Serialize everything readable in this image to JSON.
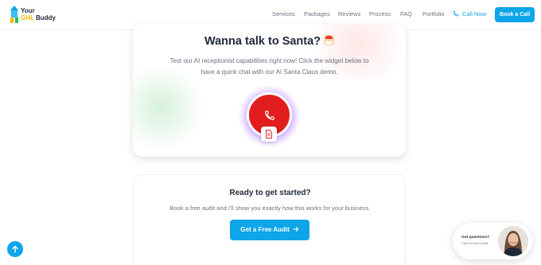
{
  "header": {
    "logo": {
      "line1": "Your",
      "line2_accent": "GHL",
      "line2_rest": "Buddy"
    },
    "nav": [
      {
        "label": "Services"
      },
      {
        "label": "Packages"
      },
      {
        "label": "Reviews"
      },
      {
        "label": "Process"
      },
      {
        "label": "FAQ"
      },
      {
        "label": "Portfolio"
      }
    ],
    "call_now_label": "Call Now",
    "book_call_label": "Book a Call"
  },
  "santa": {
    "title": "Wanna talk to Santa?",
    "description": "Test our AI receptionist capabilities right now! Click the widget below to have a quick chat with our AI Santa Claus demo."
  },
  "cta": {
    "title": "Ready to get started?",
    "description": "Book a free audit and I'll show you exactly how this works for your business.",
    "button_label": "Get a Free Audit"
  },
  "chat": {
    "title": "Got questions?",
    "subtitle": "Click the icon to talk"
  },
  "colors": {
    "accent": "#0ea5e9",
    "call_widget": "#e11d1d",
    "logo_accent": "#f5b800"
  }
}
